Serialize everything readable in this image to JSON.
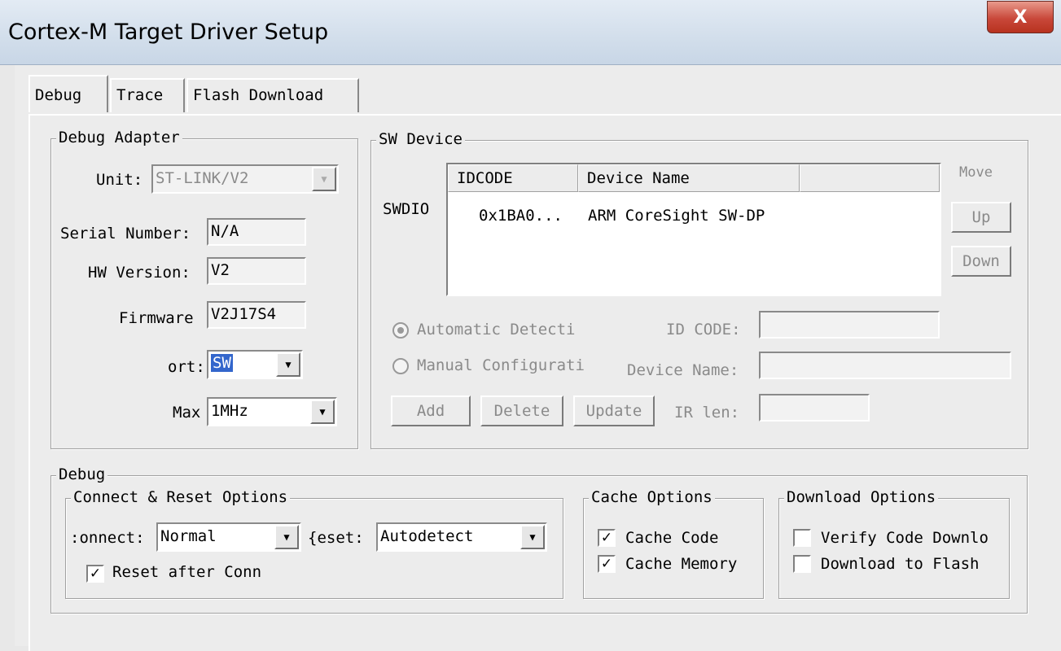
{
  "window": {
    "title": "Cortex-M Target Driver Setup",
    "close_glyph": "X"
  },
  "tabs": [
    {
      "label": "Debug",
      "active": true
    },
    {
      "label": "Trace",
      "active": false
    },
    {
      "label": "Flash Download",
      "active": false
    }
  ],
  "debug_adapter": {
    "title": "Debug Adapter",
    "unit_label": "Unit:",
    "unit_value": "ST-LINK/V2",
    "serial_label": "Serial Number:",
    "serial_value": "N/A",
    "hw_label": "HW Version:",
    "hw_value": "V2",
    "firmware_label": "Firmware",
    "firmware_value": "V2J17S4",
    "port_label": "ort:",
    "port_value": "SW",
    "max_label": "Max",
    "max_value": "1MHz"
  },
  "sw_device": {
    "title": "SW Device",
    "row_label": "SWDIO",
    "columns": [
      "IDCODE",
      "Device Name"
    ],
    "rows": [
      {
        "idcode": "0x1BA0...",
        "device_name": "ARM CoreSight SW-DP"
      }
    ],
    "move_label": "Move",
    "up_label": "Up",
    "down_label": "Down",
    "auto_label": "Automatic Detecti",
    "manual_label": "Manual Configurati",
    "id_code_label": "ID CODE:",
    "device_name_label": "Device Name:",
    "ir_len_label": "IR len:",
    "add_label": "Add",
    "delete_label": "Delete",
    "update_label": "Update",
    "selected_mode": "automatic"
  },
  "debug": {
    "title": "Debug",
    "connect_reset": {
      "title": "Connect & Reset Options",
      "connect_label": ":onnect:",
      "connect_value": "Normal",
      "reset_label": "{eset:",
      "reset_value": "Autodetect",
      "reset_after_label": "Reset after Conn",
      "reset_after_checked": true
    },
    "cache": {
      "title": "Cache Options",
      "code_label": "Cache Code",
      "code_checked": true,
      "memory_label": "Cache Memory",
      "memory_checked": true
    },
    "download": {
      "title": "Download Options",
      "verify_label": "Verify Code Downlo",
      "verify_checked": false,
      "flash_label": "Download to Flash",
      "flash_checked": false
    }
  },
  "icons": {
    "dropdown": "▼",
    "check": "✓"
  },
  "colors": {
    "selection": "#3366cc",
    "close_button": "#c9483a"
  }
}
